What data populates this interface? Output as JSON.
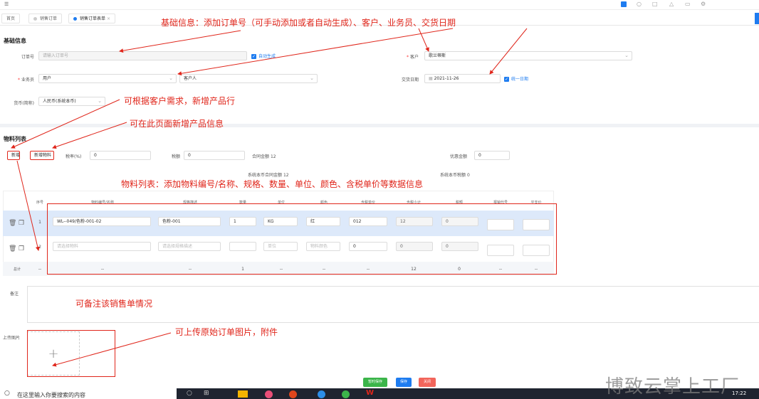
{
  "tabs": [
    {
      "label": "首页"
    },
    {
      "label": "销售订单"
    },
    {
      "label": "销售订单表单",
      "close": "×"
    }
  ],
  "basic": {
    "section_title": "基础信息",
    "order_no_label": "订单号",
    "order_no_placeholder": "请输入订单号",
    "auto_gen_label": "自动生成",
    "customer_label": "客户",
    "customer_value": "歌兰蒂斯",
    "salesman_label": "业务员",
    "salesman_value1": "用户",
    "salesman_value2": "客户人",
    "delivery_label": "交货日期",
    "delivery_value": "2021-11-26",
    "unified_date_label": "统一日期",
    "currency_label": "货币(简称)",
    "currency_value": "人民币(系统本币)"
  },
  "materials": {
    "section_title": "物料列表",
    "add_btn": "新增",
    "add_material_btn": "新增物料",
    "tax_rate_label": "税率(%)",
    "tax_rate_value": "0",
    "tax_amount_label": "税额",
    "tax_amount_value": "0",
    "contract_amount_label": "合同金额",
    "contract_amount_value": "12",
    "discount_label": "优惠金额",
    "discount_value": "0",
    "sys_contract_label": "系统本币合同金额",
    "sys_contract_value": "12",
    "sys_tax_label": "系统本币税额",
    "sys_tax_value": "0",
    "headers": [
      "序号",
      "物料编号/名称",
      "规格描述",
      "数量",
      "单位",
      "颜色",
      "含税单价",
      "含税小计",
      "税额",
      "报销代号",
      "平支价"
    ],
    "row1": {
      "index": "1",
      "code": "WL--049/色粉-001-02",
      "spec": "色粉-001",
      "qty": "1",
      "unit": "KG",
      "color": "红",
      "price": "012",
      "subtotal": "12",
      "tax": "0"
    },
    "row2": {
      "index": "2",
      "code_ph": "请选择物料",
      "spec_ph": "请选择规格描述",
      "unit_ph": "单位",
      "color_ph": "物料颜色",
      "price": "0",
      "subtotal": "0",
      "tax": "0"
    },
    "total": {
      "label": "总计",
      "index": "--",
      "code": "--",
      "spec": "--",
      "qty": "1",
      "unit": "--",
      "color": "--",
      "price": "--",
      "subtotal": "12",
      "tax": "0",
      "c10": "--",
      "c11": "--"
    }
  },
  "remark_label": "备注",
  "upload_label": "上传图片",
  "upload_plus": "+",
  "footer": {
    "temp_save": "暂时保存",
    "save": "保存",
    "close": "关闭"
  },
  "taskbar": {
    "search": "在这里输入你要搜索的内容",
    "time": "17:22"
  },
  "watermark": "博致云掌上工厂",
  "annotations": {
    "a1": "基础信息：添加订单号（可手动添加或者自动生成）、客户、业务员、交货日期",
    "a2": "可根据客户需求，新增产品行",
    "a3": "可在此页面新增产品信息",
    "a4": "物料列表：添加物料编号/名称、规格、数量、单位、颜色、含税单价等数据信息",
    "a5": "可备注该销售单情况",
    "a6": "可上传原始订单图片，附件"
  },
  "colors": {
    "accent": "#1e7cf0",
    "annotation": "#e0261b",
    "row_highlight": "#dde9fa",
    "save_green": "#3bb54a",
    "close_red": "#f2655b"
  }
}
